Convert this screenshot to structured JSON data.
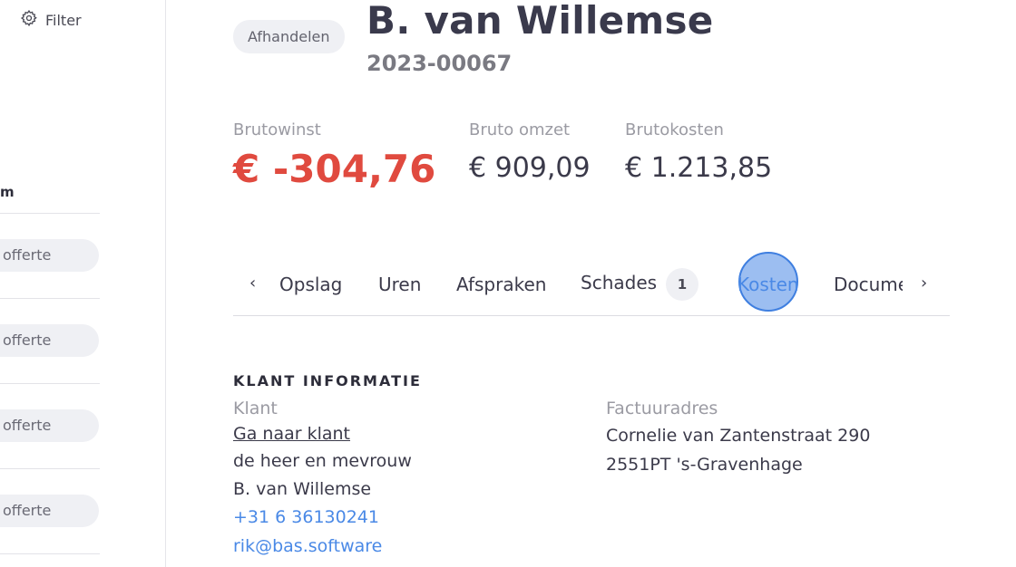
{
  "sidebar": {
    "filter_label": "Filter",
    "column_header": "m",
    "items": [
      {
        "label": "offerte"
      },
      {
        "label": "offerte"
      },
      {
        "label": "offerte"
      },
      {
        "label": "offerte"
      }
    ]
  },
  "header": {
    "status_badge": "Afhandelen",
    "title": "B. van Willemse",
    "subtitle": "2023-00067"
  },
  "kpis": {
    "brutowinst": {
      "label": "Brutowinst",
      "value": "€ -304,76"
    },
    "bruto_omzet": {
      "label": "Bruto omzet",
      "value": "€ 909,09"
    },
    "brutokosten": {
      "label": "Brutokosten",
      "value": "€ 1.213,85"
    }
  },
  "tabs": {
    "items": [
      {
        "label": "Opslag"
      },
      {
        "label": "Uren"
      },
      {
        "label": "Afspraken"
      },
      {
        "label": "Schades",
        "count": "1"
      },
      {
        "label": "Kosten"
      },
      {
        "label": "Documenten"
      }
    ],
    "active": "Kosten"
  },
  "klant_info": {
    "section_title": "KLANT INFORMATIE",
    "klant_label": "Klant",
    "goto_link": "Ga naar klant",
    "salutation": "de heer en mevrouw",
    "name": "B. van Willemse",
    "phone": "+31 6 36130241",
    "email": "rik@bas.software",
    "factuur_label": "Factuuradres",
    "street": "Cornelie van Zantenstraat 290",
    "city": "2551PT 's-Gravenhage"
  },
  "colors": {
    "accent": "#4a89e6",
    "negative": "#e04a3f",
    "pill_bg": "#eff0f4"
  }
}
